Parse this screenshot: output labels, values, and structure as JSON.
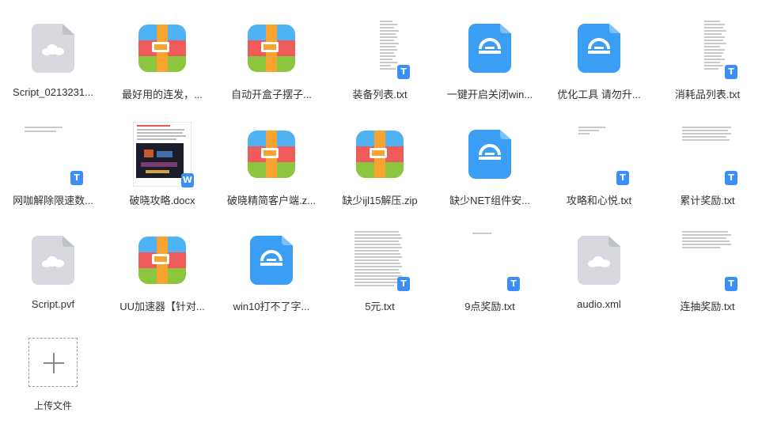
{
  "files": [
    {
      "name": "Script_0213231...",
      "type": "cloud"
    },
    {
      "name": "最好用的连发，...",
      "type": "archive"
    },
    {
      "name": "自动开盒子摆子...",
      "type": "archive"
    },
    {
      "name": "装备列表.txt",
      "type": "txt"
    },
    {
      "name": "一键开启关闭win...",
      "type": "app"
    },
    {
      "name": "优化工具 请勿升...",
      "type": "app"
    },
    {
      "name": "消耗品列表.txt",
      "type": "txt"
    },
    {
      "name": "网咖解除限速数...",
      "type": "txt"
    },
    {
      "name": "破晓攻略.docx",
      "type": "docx"
    },
    {
      "name": "破晓精简客户端.z...",
      "type": "archive"
    },
    {
      "name": "缺少ijl15解压.zip",
      "type": "archive"
    },
    {
      "name": "缺少NET组件安...",
      "type": "app"
    },
    {
      "name": "攻略和心悦.txt",
      "type": "txt"
    },
    {
      "name": "累计奖励.txt",
      "type": "txt"
    },
    {
      "name": "Script.pvf",
      "type": "cloud"
    },
    {
      "name": "UU加速器【针对...",
      "type": "archive"
    },
    {
      "name": "win10打不了字...",
      "type": "app"
    },
    {
      "name": "5元.txt",
      "type": "txt"
    },
    {
      "name": "9点奖励.txt",
      "type": "txt"
    },
    {
      "name": "audio.xml",
      "type": "cloud"
    },
    {
      "name": "连抽奖励.txt",
      "type": "txt"
    }
  ],
  "badges": {
    "txt": "T",
    "docx": "W"
  },
  "upload": {
    "label": "上传文件"
  },
  "colors": {
    "accent": "#3a9ef5",
    "badge": "#3a8ef6"
  }
}
